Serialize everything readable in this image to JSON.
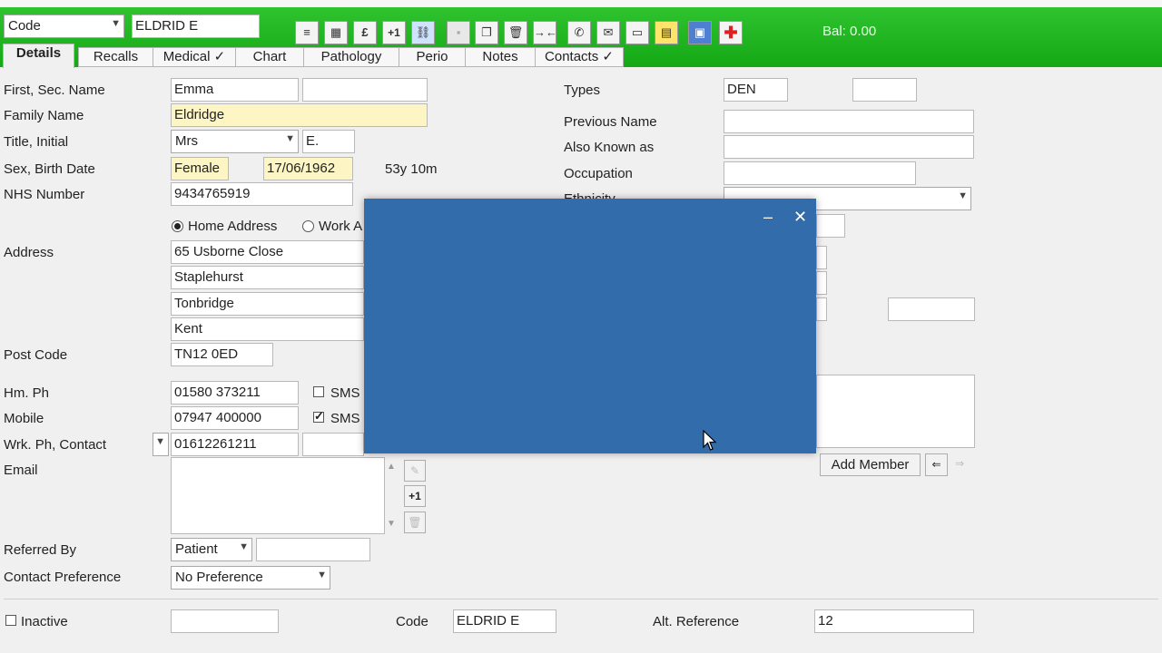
{
  "toolbar": {
    "code_select": "Code",
    "code_value": "ELDRID E",
    "balance": "Bal: 0.00",
    "btn_plus1": "+1",
    "btn_pound": "£"
  },
  "tabs": [
    {
      "label": "Details"
    },
    {
      "label": "Recalls"
    },
    {
      "label": "Medical ✓"
    },
    {
      "label": "Chart"
    },
    {
      "label": "Pathology"
    },
    {
      "label": "Perio"
    },
    {
      "label": "Notes"
    },
    {
      "label": "Contacts ✓"
    }
  ],
  "left": {
    "first_sec_name_label": "First, Sec. Name",
    "first_name": "Emma",
    "second_name": "",
    "family_name_label": "Family Name",
    "family_name": "Eldridge",
    "title_initial_label": "Title, Initial",
    "title": "Mrs",
    "initial": "E.",
    "sex_birth_label": "Sex, Birth Date",
    "sex": "Female",
    "birth_date": "17/06/1962",
    "age": "53y 10m",
    "nhs_label": "NHS Number",
    "nhs_number": "9434765919",
    "home_address_label": "Home Address",
    "work_address_label": "Work A",
    "address_label": "Address",
    "address_lines": [
      "65 Usborne Close",
      "Staplehurst",
      "Tonbridge",
      "Kent"
    ],
    "postcode_label": "Post Code",
    "postcode": "TN12 0ED",
    "hm_ph_label": "Hm. Ph",
    "hm_ph": "01580 373211",
    "mobile_label": "Mobile",
    "mobile": "07947 400000",
    "wrk_label": "Wrk. Ph, Contact",
    "wrk_ph": "01612261211",
    "sms_label": "SMS",
    "email_label": "Email",
    "email_plus1": "+1",
    "referred_label": "Referred By",
    "referred_by": "Patient",
    "contact_pref_label": "Contact Preference",
    "contact_pref": "No Preference"
  },
  "right": {
    "types_label": "Types",
    "types": "DEN",
    "previous_name_label": "Previous Name",
    "aka_label": "Also Known as",
    "occupation_label": "Occupation",
    "ethnicity_label": "Ethnicity",
    "add_member": "Add Member"
  },
  "bottom": {
    "inactive_label": "Inactive",
    "code_label": "Code",
    "code_value": "ELDRID E",
    "alt_ref_label": "Alt. Reference",
    "alt_ref": "12"
  },
  "modal": {
    "minimize": "–",
    "close": "✕"
  }
}
